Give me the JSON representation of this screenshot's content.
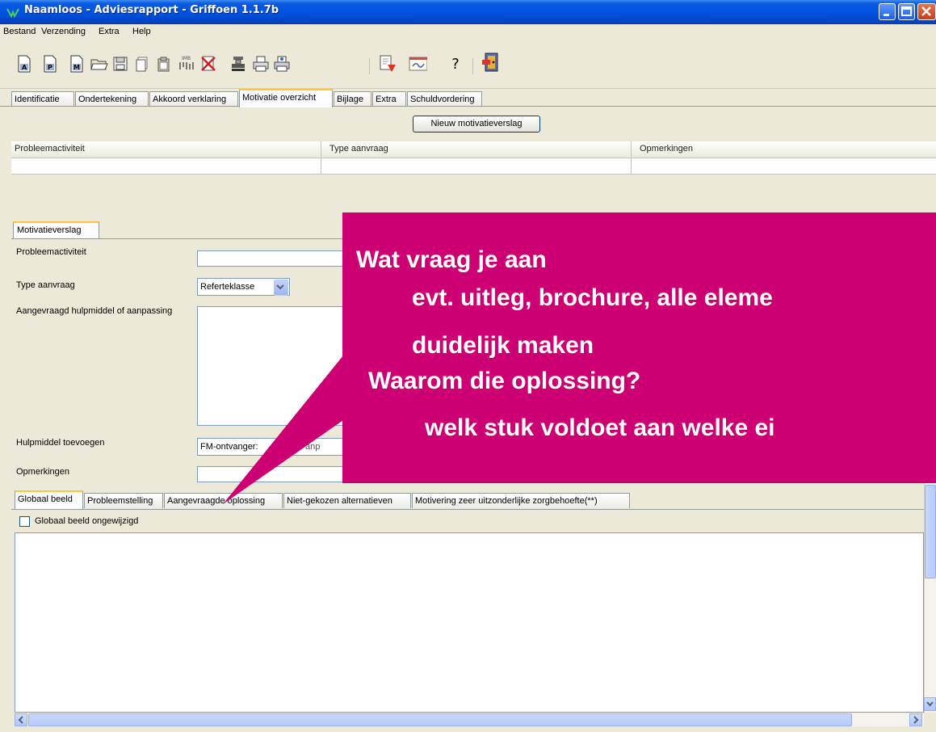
{
  "window": {
    "title": "Naamloos - Adviesrapport - Griffoen 1.1.7b"
  },
  "menu": [
    "Bestand",
    "Verzending",
    "Extra",
    "Help"
  ],
  "toolbar": {
    "imb_label": "IMB",
    "help_label": "?"
  },
  "main_tabs": [
    "Identificatie",
    "Ondertekening",
    "Akkoord verklaring",
    "Motivatie overzicht",
    "Bijlage",
    "Extra",
    "Schuldvordering"
  ],
  "overview": {
    "new_button": "Nieuw motivatieverslag",
    "columns": [
      "Probleemactiviteit",
      "Type aanvraag",
      "Opmerkingen"
    ]
  },
  "form": {
    "tab": "Motivatieverslag",
    "labels": {
      "probleemactiviteit": "Probleemactiviteit",
      "type_aanvraag": "Type aanvraag",
      "hulpmiddel": "Aangevraagd hulpmiddel of aanpassing",
      "toevoegen": "Hulpmiddel toevoegen",
      "opmerkingen": "Opmerkingen"
    },
    "type_value": "Referteklasse",
    "toevoegen_value": "FM-ontvanger:",
    "toevoegen_value_tail": "anp"
  },
  "bottom_tabs": [
    "Globaal beeld",
    "Probleemstelling",
    "Aangevraagde oplossing",
    "Niet-gekozen alternatieven",
    "Motivering zeer uitzonderlijke zorgbehoefte(**)"
  ],
  "checkbox_label": "Globaal beeld ongewijzigd",
  "callout": {
    "line1": "Wat vraag je aan",
    "line2": "evt. uitleg, brochure, alle eleme",
    "line3": "duidelijk maken",
    "line4": "Waarom die oplossing?",
    "line5": "welk stuk voldoet aan welke ei"
  },
  "colors": {
    "callout": "#cc0072",
    "titlebar": "#0054e3",
    "tab_highlight": "#ffc83c"
  }
}
